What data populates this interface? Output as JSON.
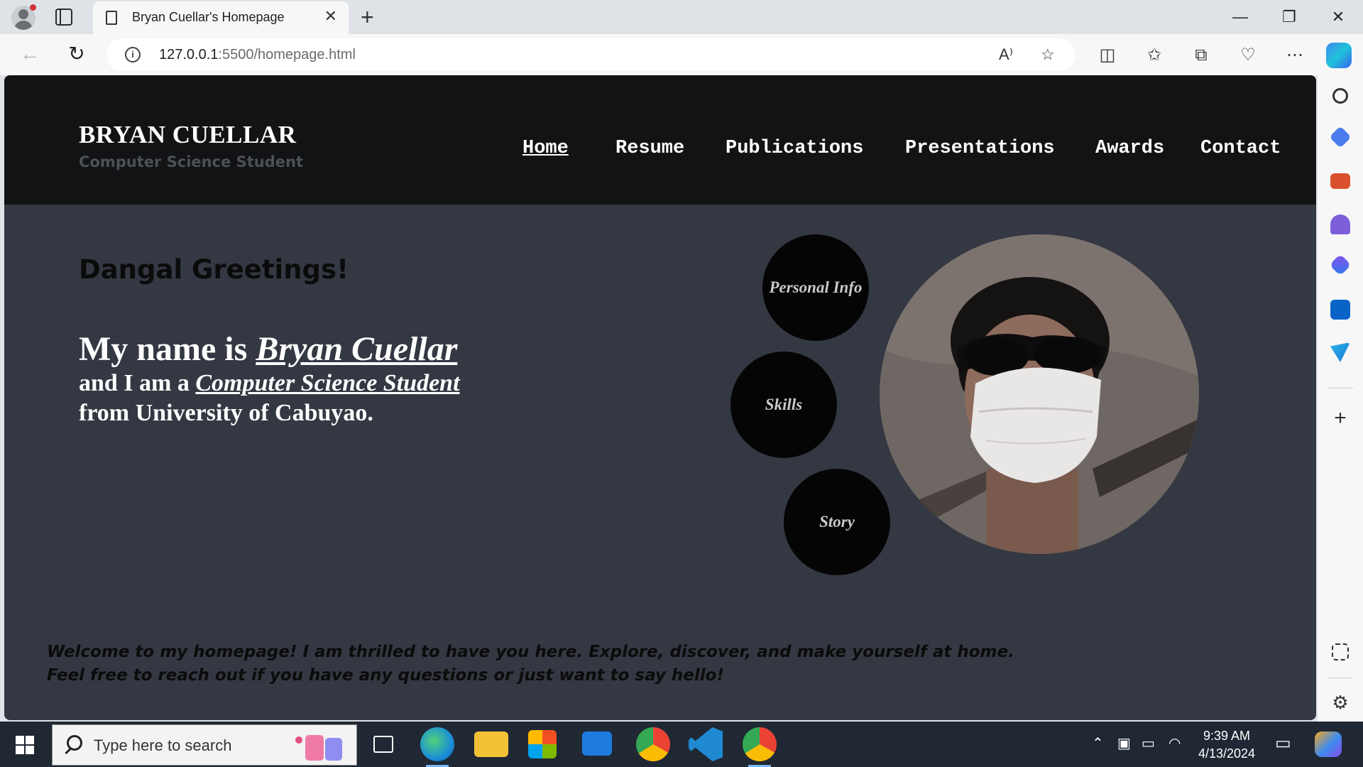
{
  "browser": {
    "tab_title": "Bryan Cuellar's Homepage",
    "url_host": "127.0.0.1",
    "url_rest": ":5500/homepage.html",
    "read_aloud": "A⁾"
  },
  "site": {
    "brand_name": "BRYAN CUELLAR",
    "brand_tagline": "Computer Science Student",
    "nav": [
      "Home",
      "Resume",
      "Publications",
      "Presentations",
      "Awards",
      "Contact"
    ],
    "active_nav": "Home",
    "greeting": "Dangal Greetings!",
    "intro": {
      "l1_prefix": "My name is ",
      "name": "Bryan Cuellar",
      "l2_prefix": "and I am a ",
      "role": "Computer Science Student",
      "l3": "from University of Cabuyao."
    },
    "bubbles": [
      "Personal Info",
      "Skills",
      "Story"
    ],
    "welcome_line1": "Welcome to my homepage! I am thrilled to have you here. Explore, discover, and make yourself at home.",
    "welcome_line2": "Feel free to reach out if you have any questions or just want to say hello!"
  },
  "taskbar": {
    "search_placeholder": "Type here to search",
    "time": "9:39 AM",
    "date": "4/13/2024"
  },
  "colors": {
    "header_bg": "#121315",
    "page_bg": "#343842",
    "bubble_bg": "#050505",
    "taskbar_bg": "#1f2833"
  }
}
